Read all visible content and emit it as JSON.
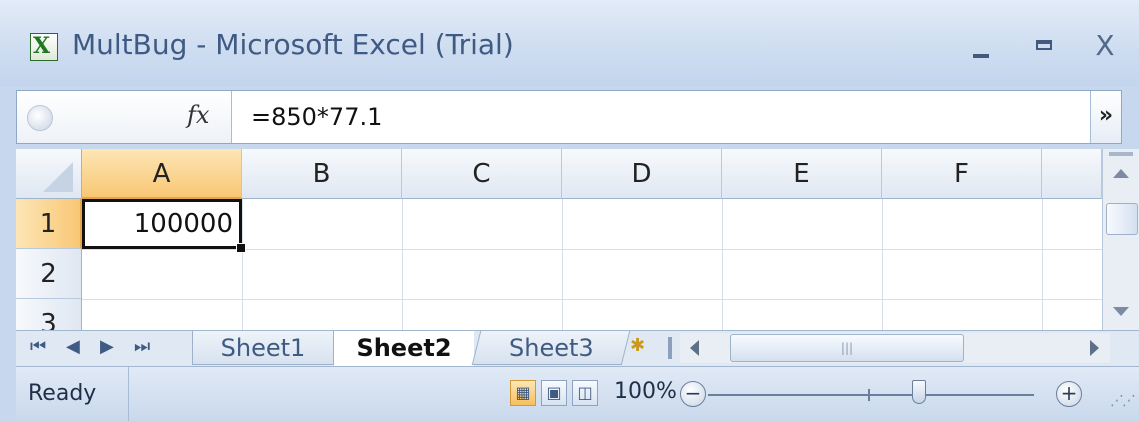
{
  "window": {
    "title": "MultBug - Microsoft Excel (Trial)",
    "app_icon": "excel-icon",
    "controls": {
      "minimize": "_",
      "maximize": "□",
      "close": "X"
    }
  },
  "formula_bar": {
    "name_box_value": "",
    "fx_label": "fx",
    "formula": "=850*77.1",
    "expand_glyph": "»"
  },
  "grid": {
    "columns": [
      "A",
      "B",
      "C",
      "D",
      "E",
      "F"
    ],
    "rows": [
      "1",
      "2",
      "3"
    ],
    "selected_column": "A",
    "selected_row": "1",
    "active_cell": {
      "ref": "A1",
      "value": "100000"
    }
  },
  "sheet_tabs": {
    "nav": [
      "first",
      "previous",
      "next",
      "last"
    ],
    "tabs": [
      {
        "label": "Sheet1",
        "active": false
      },
      {
        "label": "Sheet2",
        "active": true
      },
      {
        "label": "Sheet3",
        "active": false
      }
    ]
  },
  "status_bar": {
    "status": "Ready",
    "zoom": "100%",
    "zoom_out_glyph": "−",
    "zoom_in_glyph": "+"
  },
  "colors": {
    "selection_highlight": "#f8c774",
    "window_chrome": "#c7d8ee",
    "title_text": "#3f5a83"
  }
}
